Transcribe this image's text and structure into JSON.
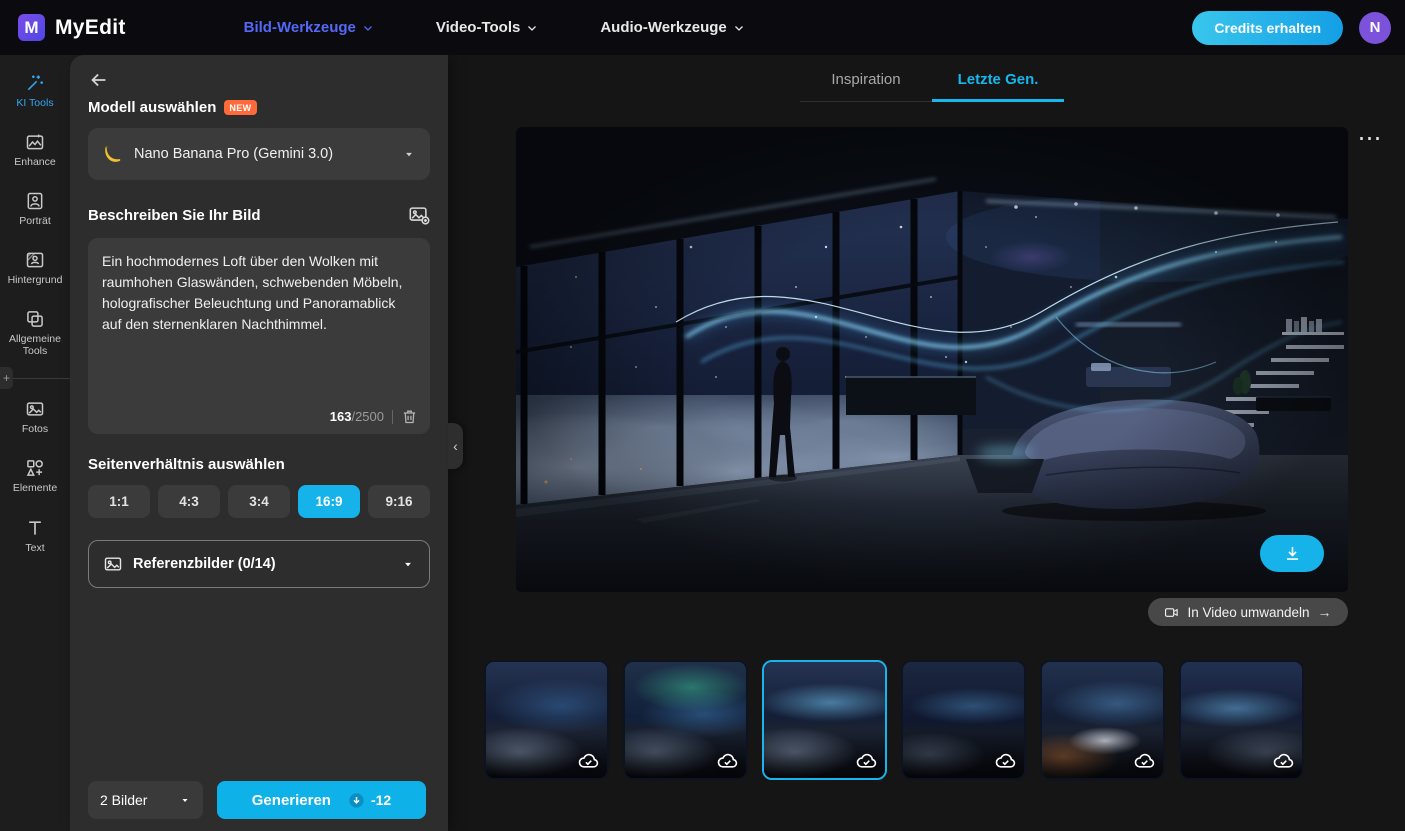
{
  "navbar": {
    "logo_text": "MyEdit",
    "logo_glyph": "M",
    "menus": [
      {
        "label": "Bild-Werkzeuge",
        "active": true
      },
      {
        "label": "Video-Tools",
        "active": false
      },
      {
        "label": "Audio-Werkzeuge",
        "active": false
      }
    ],
    "credits_button": "Credits erhalten",
    "avatar_initial": "N"
  },
  "rail": {
    "items": [
      {
        "label": "KI Tools",
        "active": true
      },
      {
        "label": "Enhance",
        "active": false
      },
      {
        "label": "Porträt",
        "active": false
      },
      {
        "label": "Hintergrund",
        "active": false
      },
      {
        "label": "Allgemeine Tools",
        "active": false
      },
      {
        "label": "Fotos",
        "active": false
      },
      {
        "label": "Elemente",
        "active": false
      },
      {
        "label": "Text",
        "active": false
      }
    ]
  },
  "panel": {
    "model_section_title": "Modell auswählen",
    "new_badge": "NEW",
    "model_name": "Nano Banana Pro (Gemini 3.0)",
    "describe_title": "Beschreiben Sie Ihr Bild",
    "prompt_text": "Ein hochmodernes Loft über den Wolken mit raumhohen Glaswänden, schwebenden Möbeln, holografischer Beleuchtung und Panoramablick auf den sternenklaren Nachthimmel.",
    "char_count": "163",
    "char_max": "/2500",
    "aspect_title": "Seitenverhältnis auswählen",
    "aspect_ratios": [
      "1:1",
      "4:3",
      "3:4",
      "16:9",
      "9:16"
    ],
    "aspect_selected": "16:9",
    "reference_label": "Referenzbilder (0/14)",
    "batch_label": "2 Bilder",
    "generate_label": "Generieren",
    "credit_cost": "-12"
  },
  "main": {
    "tabs": [
      {
        "label": "Inspiration",
        "active": false
      },
      {
        "label": "Letzte Gen.",
        "active": true
      }
    ],
    "convert_button": "In Video umwandeln",
    "thumbnails_count": 6,
    "selected_thumbnail": 3
  },
  "icons": {
    "more_options": "⋯",
    "collapse": "‹",
    "arrow_right": "→",
    "add": "+"
  },
  "colors": {
    "accent_cyan": "#15b3ea",
    "nav_active_blue": "#5468f7",
    "badge_orange": "#ff6a3a",
    "avatar_purple": "#7b52d9"
  }
}
